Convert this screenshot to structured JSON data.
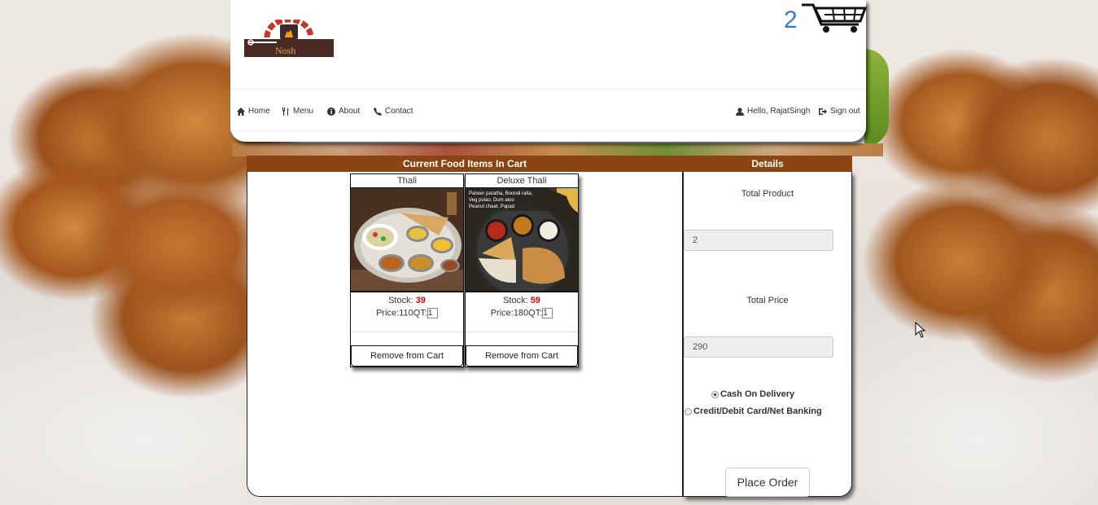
{
  "header": {
    "logo_text": "Nosh",
    "cart_count": "2"
  },
  "nav": {
    "home": "Home",
    "menu": "Menu",
    "about": "About",
    "contact": "Contact",
    "greeting": "Hello, RajatSingh",
    "sign_out": "Sign out"
  },
  "cart": {
    "heading": "Current Food Items In Cart",
    "stock_label": "Stock: ",
    "price_label": "Price:",
    "qt_label": "QT:",
    "items": [
      {
        "name": "Thali",
        "stock": "39",
        "price": "110",
        "qty": "1",
        "remove_label": "Remove from Cart"
      },
      {
        "name": "Deluxe Thali",
        "stock": "59",
        "price": "180",
        "qty": "1",
        "remove_label": "Remove from Cart",
        "image_caption": "Paneer paratha, Boondi raita, Veg pulao, Dum aloo, Peanut chaat, Papad"
      }
    ]
  },
  "details": {
    "heading": "Details",
    "total_product_label": "Total Product",
    "total_product_value": "2",
    "total_price_label": "Total Price",
    "total_price_value": "290",
    "payment_options": [
      "Cash On Delivery",
      "Credit/Debit Card/Net Banking"
    ],
    "selected_payment": "Cash On Delivery",
    "place_order_label": "Place Order"
  },
  "colors": {
    "brown_header": "#8a4513",
    "stock_red": "#dd0000",
    "cart_blue": "#3a7bbf"
  }
}
